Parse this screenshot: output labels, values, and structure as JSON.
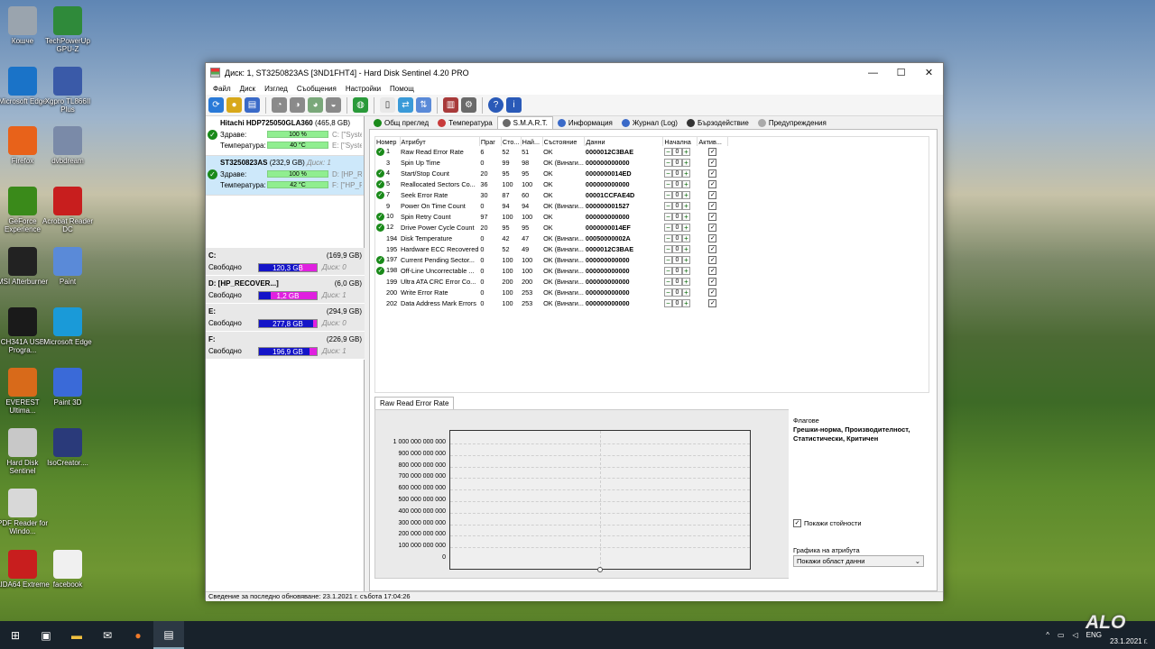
{
  "desktop": {
    "icons": [
      {
        "label": "Кошче",
        "name": "recycle-bin-icon",
        "color": "#9aa4ae"
      },
      {
        "label": "TechPowerUp GPU-Z",
        "name": "gpuz-icon",
        "color": "#2f8a3a"
      },
      {
        "label": "Microsoft Edge",
        "name": "edge-icon",
        "color": "#1a73c8"
      },
      {
        "label": "Xgpro TL866II Plus",
        "name": "xgpro-icon",
        "color": "#3a5aa8"
      },
      {
        "label": "Firefox",
        "name": "firefox-icon",
        "color": "#e8621a"
      },
      {
        "label": "dvbdream",
        "name": "dvbdream-icon",
        "color": "#7a8aa8"
      },
      {
        "label": "GeForce Experience",
        "name": "geforce-icon",
        "color": "#3a8a1a"
      },
      {
        "label": "Acrobat Reader DC",
        "name": "acrobat-icon",
        "color": "#c81e1e"
      },
      {
        "label": "MSI Afterburner",
        "name": "afterburner-icon",
        "color": "#222222"
      },
      {
        "label": "Paint",
        "name": "paint-icon",
        "color": "#5a8ad8"
      },
      {
        "label": "CH341A USB Progra...",
        "name": "ch341a-icon",
        "color": "#1a1a1a"
      },
      {
        "label": "Microsoft Edge",
        "name": "edge2-icon",
        "color": "#1a9ad8"
      },
      {
        "label": "EVEREST Ultima...",
        "name": "everest-icon",
        "color": "#d86a1a"
      },
      {
        "label": "Paint 3D",
        "name": "paint3d-icon",
        "color": "#3a6ad8"
      },
      {
        "label": "Hard Disk Sentinel",
        "name": "hdsentinel-icon",
        "color": "#c8c8c8"
      },
      {
        "label": "IsoCreator....",
        "name": "isocreator-icon",
        "color": "#2a3a7a"
      },
      {
        "label": "PDF Reader for Windo...",
        "name": "pdfreader-icon",
        "color": "#d8d8d8"
      },
      {
        "label": "AIDA64 Extreme",
        "name": "aida64-icon",
        "color": "#c81e1e"
      },
      {
        "label": "facebook",
        "name": "facebook-file-icon",
        "color": "#f0f0f0"
      }
    ]
  },
  "window": {
    "title": "Диск: 1, ST3250823AS [3ND1FHT4]  -  Hard Disk Sentinel 4.20 PRO",
    "minimize": "—",
    "maximize": "☐",
    "close": "✕",
    "menu": [
      "Файл",
      "Диск",
      "Изглед",
      "Съобщения",
      "Настройки",
      "Помощ"
    ]
  },
  "disks": [
    {
      "name": "Hitachi HDP725050GLA360",
      "size": "(465,8 GB)",
      "hint": "",
      "health_label": "Здраве:",
      "health": "100 %",
      "health_pct": 100,
      "health_extra": "C: [\"System R",
      "temp_label": "Температура:",
      "temp": "40 °C",
      "temp_extra": "E: [\"System Re"
    },
    {
      "name": "ST3250823AS",
      "size": "(232,9 GB)",
      "hint": "Диск: 1",
      "health_label": "Здраве:",
      "health": "100 %",
      "health_pct": 100,
      "health_extra": "D: [HP_RECOV",
      "temp_label": "Температура:",
      "temp": "42 °C",
      "temp_extra": "F: [\"HP_RECOVE"
    }
  ],
  "volumes": [
    {
      "letter": "C:",
      "total": "(169,9 GB)",
      "free_label": "Свободно",
      "free": "120,3 GB",
      "free_pct": 71,
      "disk": "Диск: 0"
    },
    {
      "letter": "D: [HP_RECOVER...]",
      "total": "(6,0 GB)",
      "free_label": "Свободно",
      "free": "1,2 GB",
      "free_pct": 20,
      "disk": "Диск: 1"
    },
    {
      "letter": "E:",
      "total": "(294,9 GB)",
      "free_label": "Свободно",
      "free": "277,8 GB",
      "free_pct": 94,
      "disk": "Диск: 0"
    },
    {
      "letter": "F:",
      "total": "(226,9 GB)",
      "free_label": "Свободно",
      "free": "196,9 GB",
      "free_pct": 87,
      "disk": "Диск: 1"
    }
  ],
  "tabs": [
    {
      "label": "Общ преглед",
      "color": "#1a8a1a"
    },
    {
      "label": "Температура",
      "color": "#c83a3a"
    },
    {
      "label": "S.M.A.R.T.",
      "color": "#6a6a6a"
    },
    {
      "label": "Информация",
      "color": "#3a6ac8"
    },
    {
      "label": "Журнал (Log)",
      "color": "#3a6ac8"
    },
    {
      "label": "Бързодействие",
      "color": "#333333"
    },
    {
      "label": "Предупреждения",
      "color": "#aaaaaa"
    }
  ],
  "smart": {
    "headers": [
      "Номер",
      "Атрибут",
      "Праг",
      "Сто...",
      "Най...",
      "Състояние",
      "Данни",
      "Начална",
      "Актив..."
    ],
    "rows": [
      {
        "ok": true,
        "num": "1",
        "attr": "Raw Read Error Rate",
        "thr": "6",
        "val": "52",
        "worst": "51",
        "state": "OK",
        "data": "0000012C3BAE",
        "init": "0"
      },
      {
        "ok": false,
        "num": "3",
        "attr": "Spin Up Time",
        "thr": "0",
        "val": "99",
        "worst": "98",
        "state": "OK (Винаги...",
        "data": "000000000000",
        "init": "0"
      },
      {
        "ok": true,
        "num": "4",
        "attr": "Start/Stop Count",
        "thr": "20",
        "val": "95",
        "worst": "95",
        "state": "OK",
        "data": "0000000014ED",
        "init": "0"
      },
      {
        "ok": true,
        "num": "5",
        "attr": "Reallocated Sectors Co...",
        "thr": "36",
        "val": "100",
        "worst": "100",
        "state": "OK",
        "data": "000000000000",
        "init": "0"
      },
      {
        "ok": true,
        "num": "7",
        "attr": "Seek Error Rate",
        "thr": "30",
        "val": "87",
        "worst": "60",
        "state": "OK",
        "data": "00001CCFAE4D",
        "init": "0"
      },
      {
        "ok": false,
        "num": "9",
        "attr": "Power On Time Count",
        "thr": "0",
        "val": "94",
        "worst": "94",
        "state": "OK (Винаги...",
        "data": "000000001527",
        "init": "0"
      },
      {
        "ok": true,
        "num": "10",
        "attr": "Spin Retry Count",
        "thr": "97",
        "val": "100",
        "worst": "100",
        "state": "OK",
        "data": "000000000000",
        "init": "0"
      },
      {
        "ok": true,
        "num": "12",
        "attr": "Drive Power Cycle Count",
        "thr": "20",
        "val": "95",
        "worst": "95",
        "state": "OK",
        "data": "0000000014EF",
        "init": "0"
      },
      {
        "ok": false,
        "num": "194",
        "attr": "Disk Temperature",
        "thr": "0",
        "val": "42",
        "worst": "47",
        "state": "OK (Винаги...",
        "data": "00050000002A",
        "init": "0"
      },
      {
        "ok": false,
        "num": "195",
        "attr": "Hardware ECC Recovered",
        "thr": "0",
        "val": "52",
        "worst": "49",
        "state": "OK (Винаги...",
        "data": "0000012C3BAE",
        "init": "0"
      },
      {
        "ok": true,
        "num": "197",
        "attr": "Current Pending Sector...",
        "thr": "0",
        "val": "100",
        "worst": "100",
        "state": "OK (Винаги...",
        "data": "000000000000",
        "init": "0"
      },
      {
        "ok": true,
        "num": "198",
        "attr": "Off-Line Uncorrectable ...",
        "thr": "0",
        "val": "100",
        "worst": "100",
        "state": "OK (Винаги...",
        "data": "000000000000",
        "init": "0"
      },
      {
        "ok": false,
        "num": "199",
        "attr": "Ultra ATA CRC Error Co...",
        "thr": "0",
        "val": "200",
        "worst": "200",
        "state": "OK (Винаги...",
        "data": "000000000000",
        "init": "0"
      },
      {
        "ok": false,
        "num": "200",
        "attr": "Write Error Rate",
        "thr": "0",
        "val": "100",
        "worst": "253",
        "state": "OK (Винаги...",
        "data": "000000000000",
        "init": "0"
      },
      {
        "ok": false,
        "num": "202",
        "attr": "Data Address Mark Errors",
        "thr": "0",
        "val": "100",
        "worst": "253",
        "state": "OK (Винаги...",
        "data": "000000000000",
        "init": "0"
      }
    ]
  },
  "graph": {
    "tab_label": "Raw Read Error Rate",
    "y_ticks": [
      "1 000 000 000 000",
      "900 000 000 000",
      "800 000 000 000",
      "700 000 000 000",
      "600 000 000 000",
      "500 000 000 000",
      "400 000 000 000",
      "300 000 000 000",
      "200 000 000 000",
      "100 000 000 000",
      "0"
    ]
  },
  "flags": {
    "title": "Флагове",
    "value": "Грешки-норма, Производителност, Статистически, Критичен",
    "show_values_label": "Покажи стойности",
    "attr_graph_label": "Графика на атрибута",
    "attr_graph_value": "Покажи област данни"
  },
  "status": "Сведение за последно обновяване: 23.1.2021 г. събота 17:04:26",
  "taskbar": {
    "lang": "ENG",
    "date": "23.1.2021 г."
  },
  "watermark": "ALO"
}
